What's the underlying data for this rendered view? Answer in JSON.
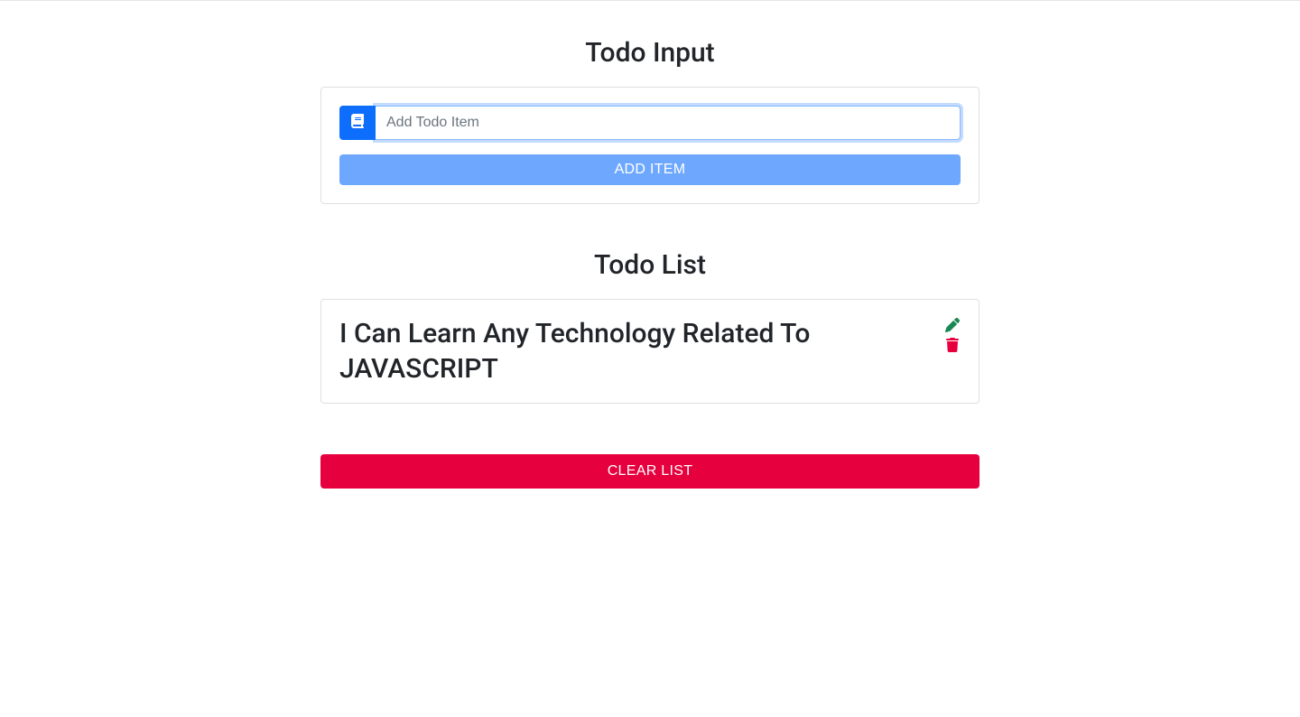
{
  "input": {
    "title": "Todo Input",
    "placeholder": "Add Todo Item",
    "value": "",
    "submit_label": "ADD ITEM",
    "prepend_icon": "book-icon"
  },
  "list": {
    "title": "Todo List",
    "items": [
      {
        "text": "I Can Learn Any Technology Related To JAVASCRIPT",
        "edit_icon": "pencil-icon",
        "delete_icon": "trash-icon"
      }
    ]
  },
  "clear": {
    "label": "CLEAR LIST"
  },
  "colors": {
    "primary": "#0d6efd",
    "primary_light": "#6ea8fe",
    "danger": "#e6003d",
    "success": "#198754"
  }
}
